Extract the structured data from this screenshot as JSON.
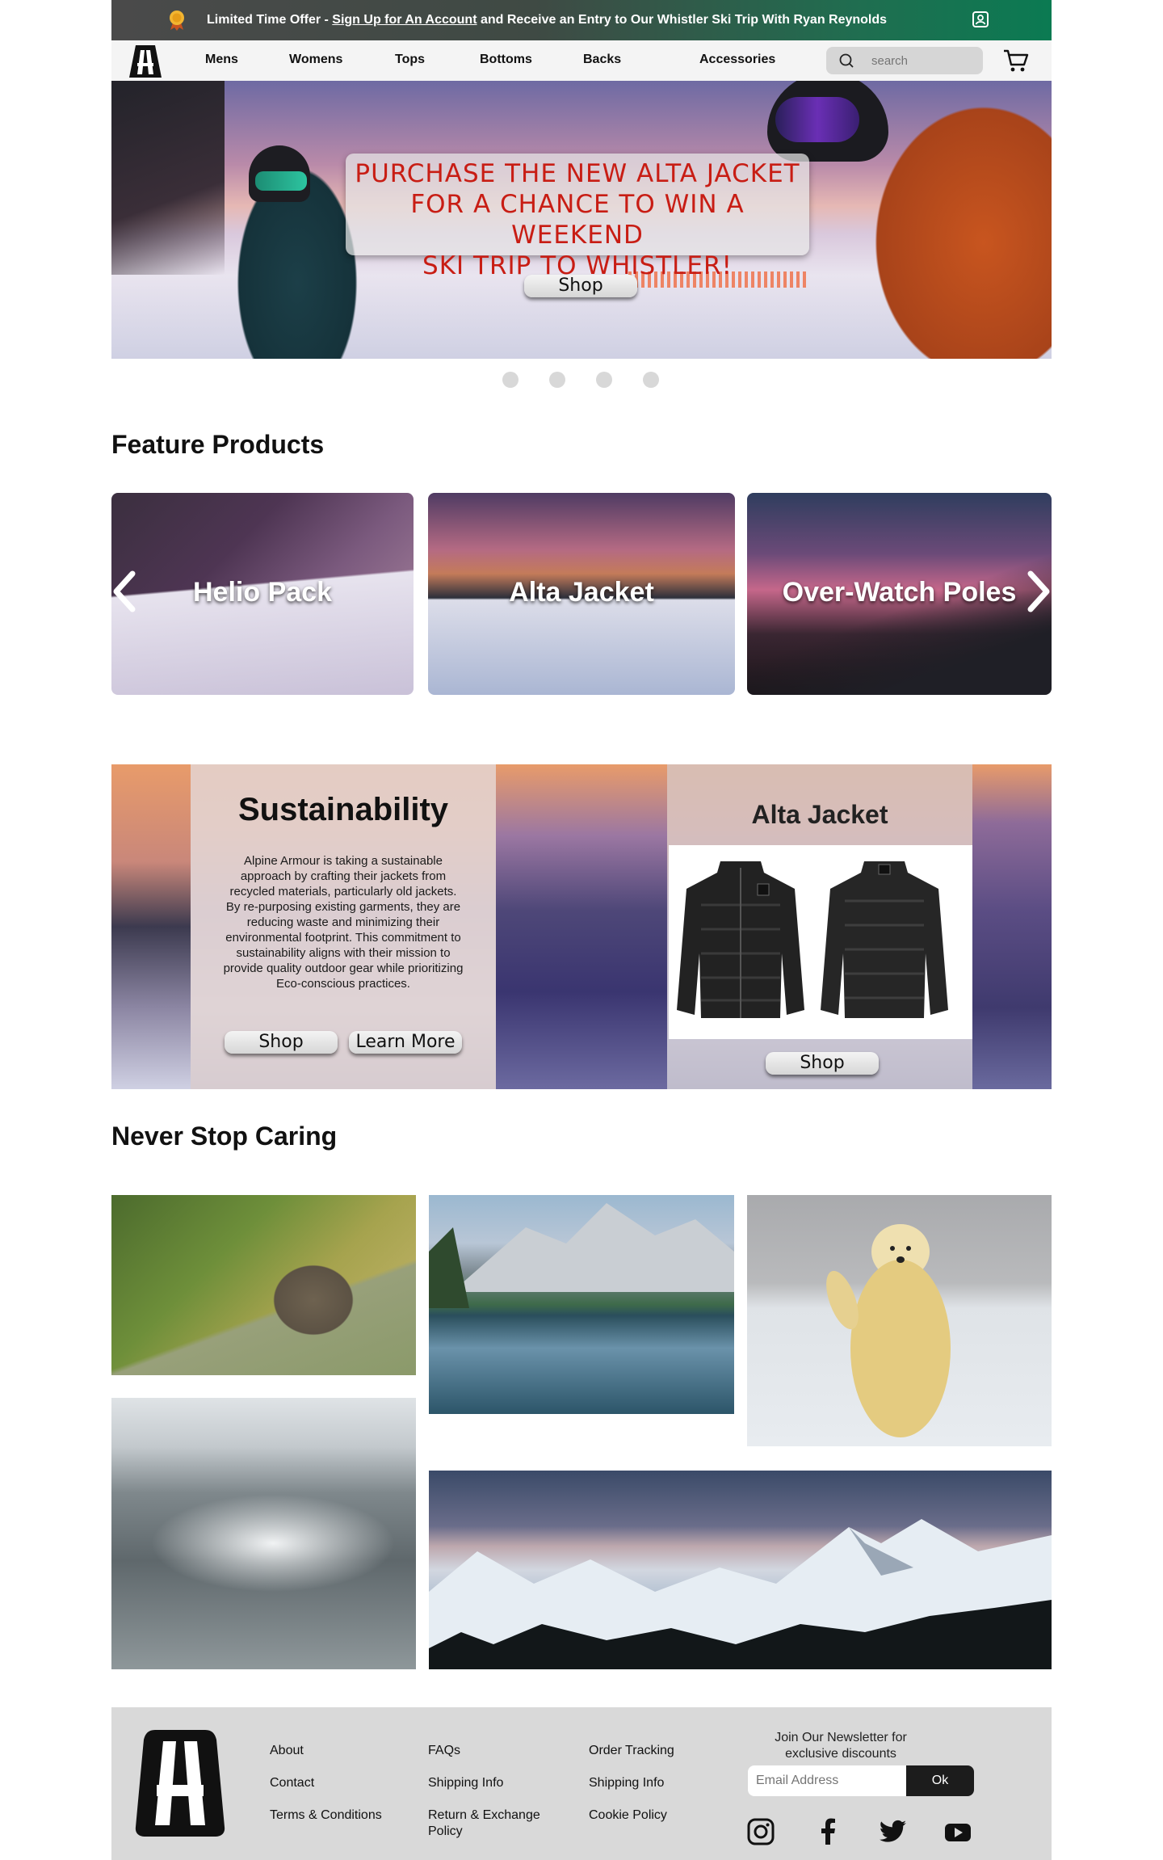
{
  "promo": {
    "prefix": "Limited Time Offer - ",
    "link": "Sign Up for An Account",
    "suffix": " and Receive an Entry to Our Whistler Ski Trip With Ryan Reynolds"
  },
  "nav": {
    "items": [
      "Mens",
      "Womens",
      "Tops",
      "Bottoms",
      "Backs",
      "Accessories"
    ],
    "search_placeholder": "search"
  },
  "hero": {
    "headline_lines": [
      "PURCHASE THE NEW ALTA JACKET",
      "FOR A CHANCE TO WIN A WEEKEND",
      "SKI TRIP TO WHISTLER!"
    ],
    "button": "Shop",
    "slide_count": 4
  },
  "featured": {
    "title": "Feature Products",
    "cards": [
      "Helio Pack",
      "Alta Jacket",
      "Over-Watch Poles"
    ]
  },
  "sustainability": {
    "title": "Sustainability",
    "body": "Alpine Armour is taking a sustainable approach by crafting their jackets from recycled materials, particularly old jackets. By re-purposing existing garments, they are reducing waste and minimizing their environmental footprint. This commitment to sustainability aligns with their mission to provide quality outdoor gear while prioritizing Eco-conscious practices.",
    "shop": "Shop",
    "learn_more": "Learn More",
    "product_title": "Alta Jacket",
    "product_shop": "Shop"
  },
  "caring": {
    "title": "Never Stop Caring"
  },
  "footer": {
    "col1": [
      "About",
      "Contact",
      "Terms & Conditions"
    ],
    "col2": [
      "FAQs",
      "Shipping Info",
      "Return & Exchange Policy"
    ],
    "col3": [
      "Order Tracking",
      "Shipping Info",
      "Cookie Policy"
    ],
    "newsletter": "Join Our Newsletter for exclusive discounts",
    "email_placeholder": "Email Address",
    "ok": "Ok"
  },
  "colors": {
    "promo_green": "#0b7a52",
    "hero_red": "#c81d14",
    "footer_bg": "#d9d9d9"
  },
  "icons": [
    "medal-icon",
    "user-icon",
    "logo-icon",
    "search-icon",
    "cart-icon",
    "chevron-left-icon",
    "chevron-right-icon",
    "instagram-icon",
    "facebook-icon",
    "twitter-icon",
    "youtube-icon"
  ]
}
